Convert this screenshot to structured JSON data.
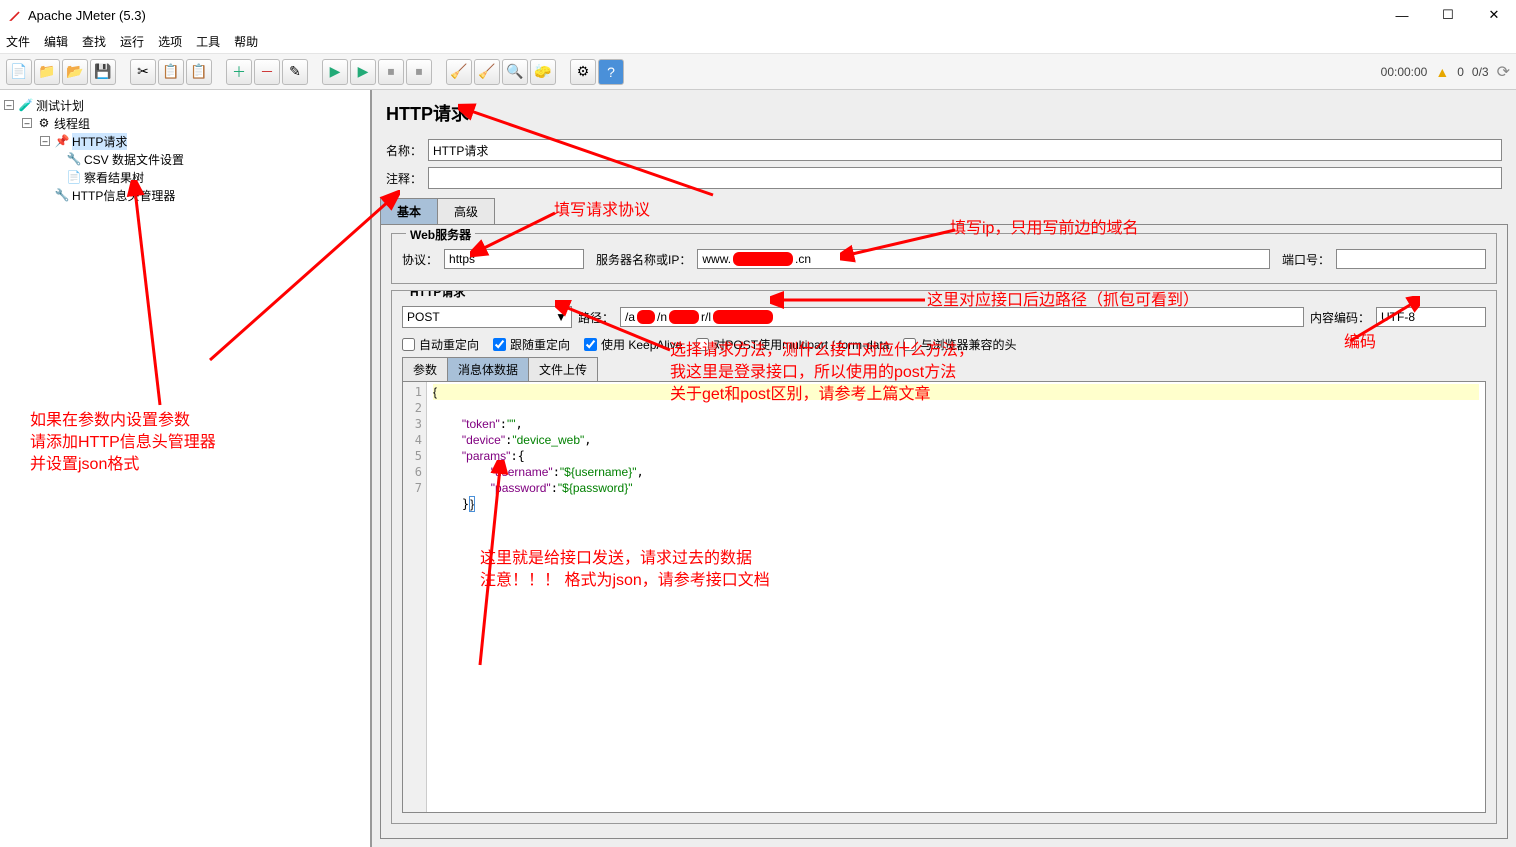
{
  "window": {
    "title": "Apache JMeter (5.3)"
  },
  "menus": [
    "文件",
    "编辑",
    "查找",
    "运行",
    "选项",
    "工具",
    "帮助"
  ],
  "toolbar_status": {
    "time": "00:00:00",
    "warn": "0",
    "threads": "0/3"
  },
  "tree": {
    "root": "测试计划",
    "group": "线程组",
    "items": [
      "HTTP请求",
      "CSV 数据文件设置",
      "察看结果树",
      "HTTP信息头管理器"
    ]
  },
  "panel": {
    "title": "HTTP请求",
    "name_label": "名称：",
    "name_value": "HTTP请求",
    "comment_label": "注释：",
    "tabs": {
      "basic": "基本",
      "advanced": "高级"
    },
    "web_server": {
      "legend": "Web服务器",
      "protocol_label": "协议：",
      "protocol_value": "https",
      "server_label": "服务器名称或IP：",
      "server_prefix": "www.",
      "server_suffix": ".cn",
      "port_label": "端口号："
    },
    "http_request": {
      "legend": "HTTP请求",
      "method": "POST",
      "path_label": "路径：",
      "path_prefix": "/a",
      "encoding_label": "内容编码：",
      "encoding_value": "UTF-8",
      "checks": {
        "auto_redirect": "自动重定向",
        "follow_redirect": "跟随重定向",
        "keepalive": "使用 KeepAlive",
        "multipart": "对POST使用multipart / form-data",
        "browser_headers": "与浏览器兼容的头"
      }
    },
    "subtabs": {
      "params": "参数",
      "body": "消息体数据",
      "files": "文件上传"
    },
    "body_lines": [
      "{",
      "    \"token\":\"\",",
      "    \"device\":\"device_web\",",
      "    \"params\":{",
      "        \"username\":\"${username}\",",
      "        \"password\":\"${password}\"",
      "    }}"
    ]
  },
  "annotations": {
    "left_block": "如果在参数内设置参数\n请添加HTTP信息头管理器\n并设置json格式",
    "protocol": "填写请求协议",
    "ip": "填写ip，只用写前边的域名",
    "path": "这里对应接口后边路径（抓包可看到）",
    "encoding": "编码",
    "method": "选择请求方法，测什么接口对应什么方法，\n我这里是登录接口，所以使用的post方法\n关于get和post区别，请参考上篇文章",
    "body": "这里就是给接口发送，请求过去的数据\n注意！！！ 格式为json，请参考接口文档"
  }
}
